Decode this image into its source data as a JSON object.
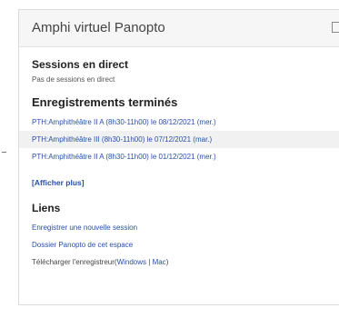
{
  "block": {
    "title": "Amphi virtuel Panopto"
  },
  "live": {
    "title": "Sessions en direct",
    "empty_text": "Pas de sessions en direct"
  },
  "recordings": {
    "title": "Enregistrements terminés",
    "items": [
      "PTH:Amphithéâtre II A (8h30-11h00) le 08/12/2021 (mer.)",
      "PTH:Amphithéâtre III (8h30-11h00) le 07/12/2021 (mar.)",
      "PTH:Amphithéâtre II A (8h30-11h00) le 01/12/2021 (mer.)"
    ],
    "highlighted_index": 1,
    "more_label": "[Afficher plus]"
  },
  "links": {
    "title": "Liens",
    "new_session": "Enregistrer une nouvelle session",
    "folder": "Dossier Panopto de cet espace",
    "download_prefix": "Télécharger l'enregistreur(",
    "windows": "Windows",
    "separator": " | ",
    "mac": "Mac",
    "download_suffix": ")"
  }
}
